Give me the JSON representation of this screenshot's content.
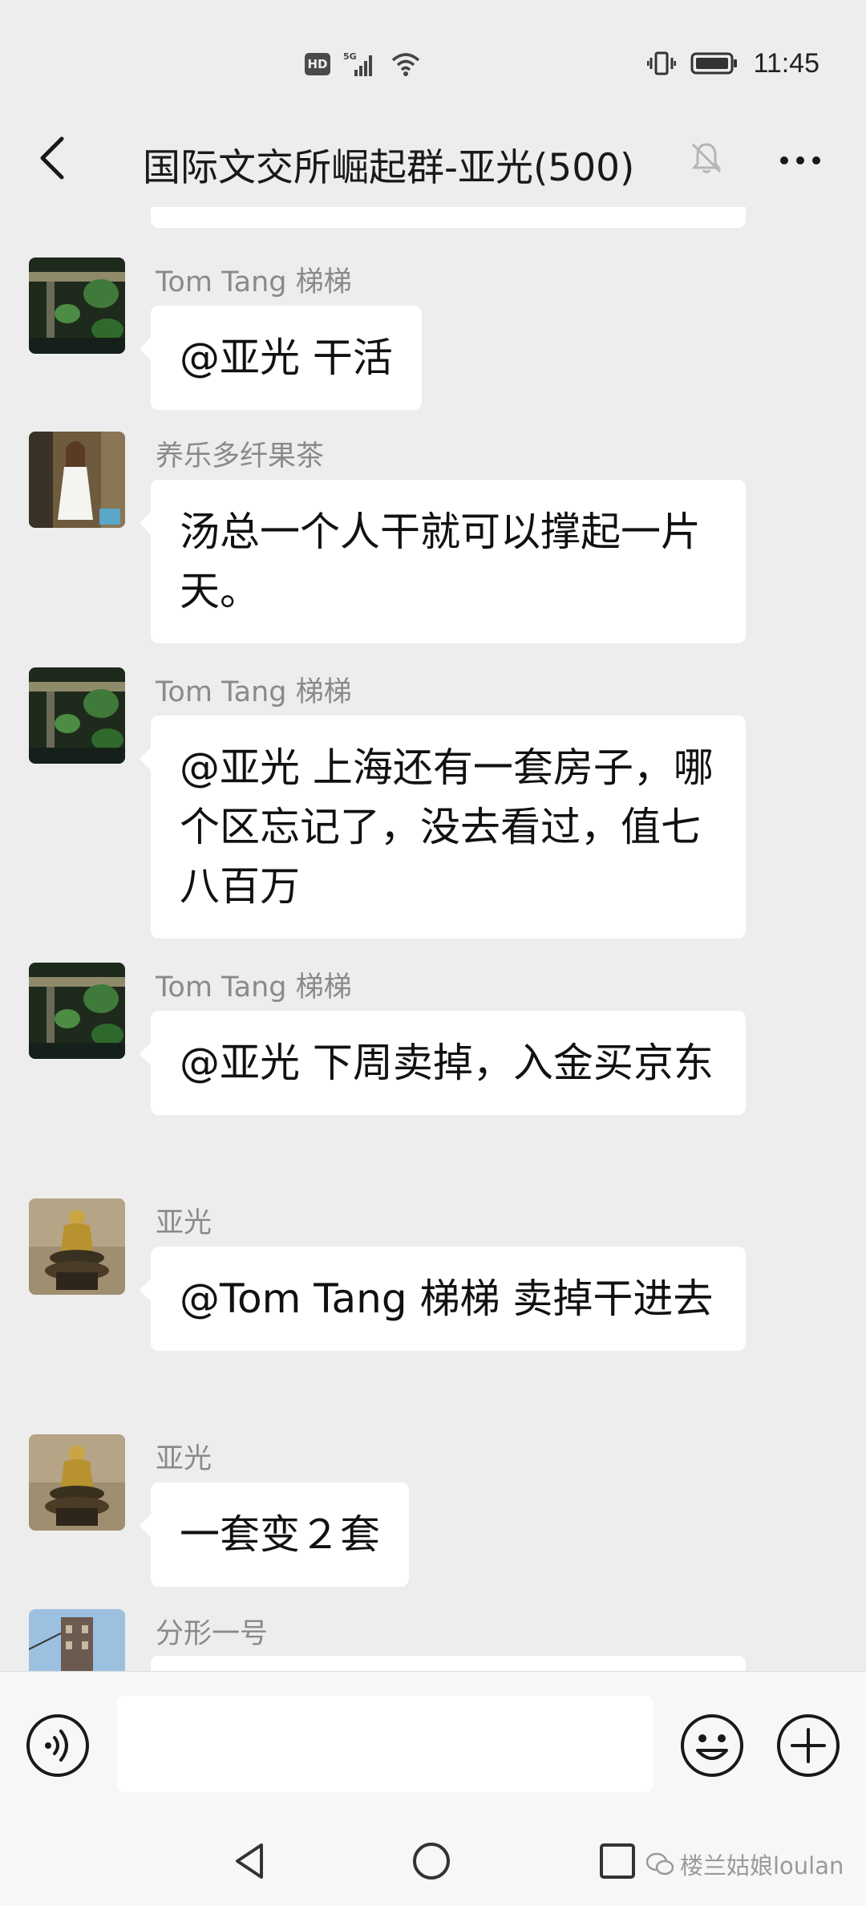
{
  "status_bar": {
    "hd": "HD",
    "network": "5G",
    "time": "11:45"
  },
  "header": {
    "title": "国际文交所崛起群-亚光(500)",
    "back_icon": "chevron-left-icon",
    "mute_icon": "bell-muted-icon",
    "more_icon": "more-dots-icon"
  },
  "messages": [
    {
      "sender": "Tom Tang 梯梯",
      "text": "@亚光  干活",
      "avatar": "lotus-garden"
    },
    {
      "sender": "养乐多纤果茶",
      "text": "汤总一个人干就可以撑起一片天。",
      "avatar": "girl-white-dress"
    },
    {
      "sender": "Tom Tang 梯梯",
      "text": "@亚光  上海还有一套房子，哪个区忘记了，没去看过，值七八百万",
      "avatar": "lotus-garden"
    },
    {
      "sender": "Tom Tang 梯梯",
      "text": "@亚光  下周卖掉，入金买京东",
      "avatar": "lotus-garden"
    },
    {
      "sender": "亚光",
      "text": "@Tom Tang 梯梯  卖掉干进去",
      "avatar": "buddha-statue"
    },
    {
      "sender": "亚光",
      "text": "一套变２套",
      "avatar": "buddha-statue"
    },
    {
      "sender": "分形一号",
      "text": "",
      "avatar": "tower-building"
    }
  ],
  "input_bar": {
    "voice_icon": "voice-icon",
    "emoji_icon": "emoji-icon",
    "plus_icon": "plus-icon",
    "input_value": ""
  },
  "nav_bar": {
    "watermark": "楼兰姑娘loulan"
  },
  "colors": {
    "background": "#ededed",
    "bubble": "#ffffff",
    "sender": "#8a8a8a",
    "text": "#111111"
  }
}
